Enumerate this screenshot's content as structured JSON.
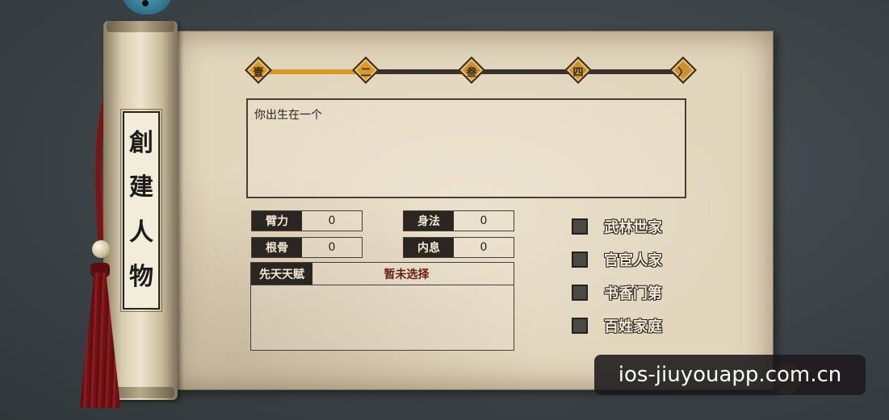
{
  "rod": {
    "title_chars": [
      "創",
      "建",
      "人",
      "物"
    ]
  },
  "progress": {
    "fill_fraction": 0.25,
    "steps": [
      {
        "glyph": "壹",
        "active": true
      },
      {
        "glyph": "二",
        "active": true
      },
      {
        "glyph": "叁",
        "active": false
      },
      {
        "glyph": "四",
        "active": false
      },
      {
        "glyph": "〉",
        "active": false
      }
    ]
  },
  "story": {
    "text": "你出生在一个"
  },
  "attributes": [
    {
      "label": "臂力",
      "value": "0"
    },
    {
      "label": "身法",
      "value": "0"
    },
    {
      "label": "根骨",
      "value": "0"
    },
    {
      "label": "内息",
      "value": "0"
    }
  ],
  "talent": {
    "label": "先天天赋",
    "value": "暂未选择"
  },
  "family_options": [
    {
      "label": "武林世家",
      "checked": false
    },
    {
      "label": "官宦人家",
      "checked": false
    },
    {
      "label": "书香门第",
      "checked": false
    },
    {
      "label": "百姓家庭",
      "checked": false
    }
  ],
  "watermark": {
    "text": "ios-jiuyouapp.com.cn"
  },
  "colors": {
    "accent": "#d99a28",
    "label_bg": "#2c2622",
    "talent_text": "#6b1c14",
    "tassel": "#8d1a1e"
  }
}
